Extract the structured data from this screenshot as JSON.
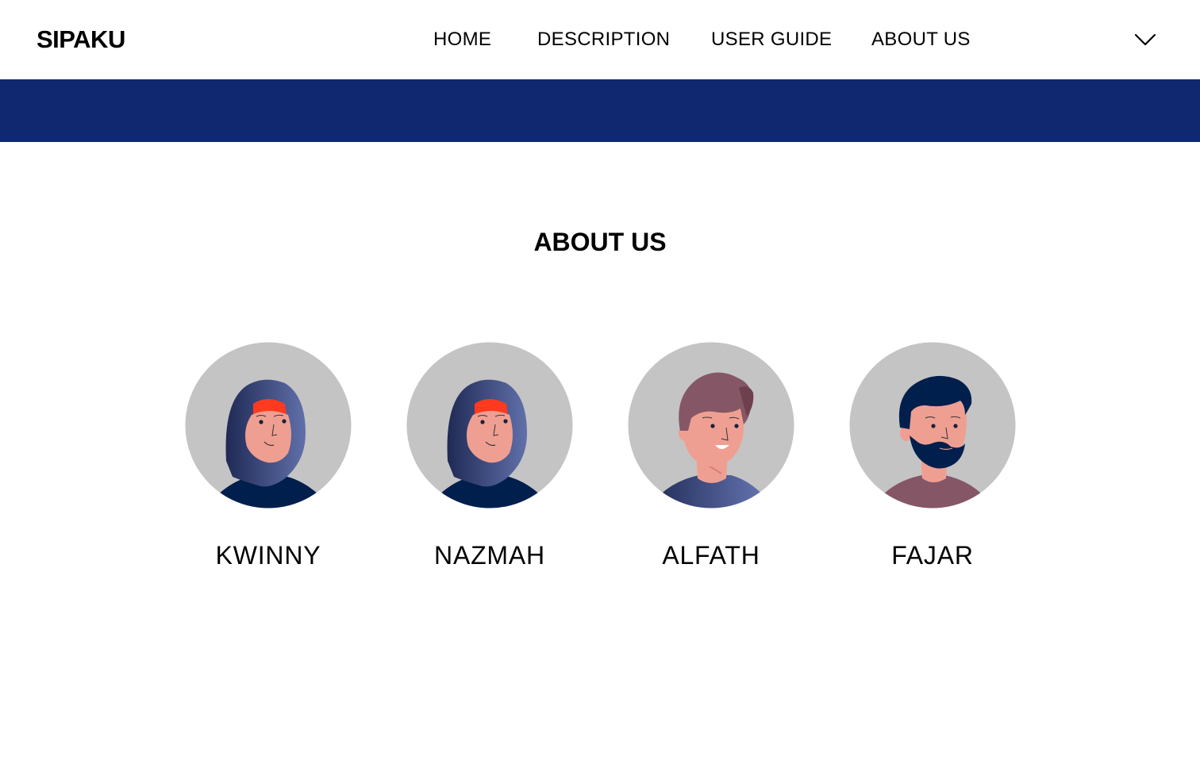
{
  "header": {
    "brand": "SIPAKU",
    "nav": [
      {
        "label": "HOME"
      },
      {
        "label": "DESCRIPTION"
      },
      {
        "label": "USER GUIDE"
      },
      {
        "label": "ABOUT US"
      }
    ],
    "menu_icon": "chevron-down-icon"
  },
  "colors": {
    "banner": "#10286f",
    "avatar_background": "#c4c4c4",
    "skin": "#ef9f92",
    "navy": "#001f4d",
    "hijab_gradient_start": "#1f2a55",
    "hijab_gradient_end": "#6170aa",
    "hair_brown": "#855766",
    "accent_red": "#ff3a1f"
  },
  "about": {
    "title": "ABOUT US",
    "members": [
      {
        "name": "KWINNY",
        "avatar": "hijab-woman-avatar"
      },
      {
        "name": "NAZMAH",
        "avatar": "hijab-woman-avatar"
      },
      {
        "name": "ALFATH",
        "avatar": "young-man-avatar"
      },
      {
        "name": "FAJAR",
        "avatar": "bearded-man-avatar"
      }
    ]
  }
}
